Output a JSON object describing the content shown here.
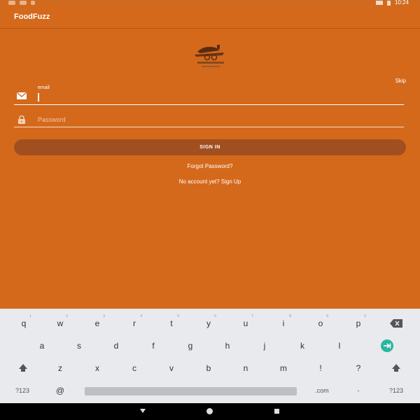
{
  "status_bar": {
    "time": "10:24"
  },
  "app_bar": {
    "title": "FoodFuzz"
  },
  "logo": {
    "icon": "restaurant-logo"
  },
  "skip_label": "Skip",
  "email_field": {
    "label": "email",
    "value": "",
    "icon": "envelope-icon"
  },
  "password_field": {
    "placeholder": "Password",
    "icon": "lock-icon"
  },
  "sign_in_label": "SIGN IN",
  "forgot_password_label": "Forgot Password?",
  "signup_prompt": "No account yet? Sign Up",
  "keyboard": {
    "row1": [
      {
        "k": "q",
        "h": "1"
      },
      {
        "k": "w",
        "h": "2"
      },
      {
        "k": "e",
        "h": "3"
      },
      {
        "k": "r",
        "h": "4"
      },
      {
        "k": "t",
        "h": "5"
      },
      {
        "k": "y",
        "h": "6"
      },
      {
        "k": "u",
        "h": "7"
      },
      {
        "k": "i",
        "h": "8"
      },
      {
        "k": "o",
        "h": "9"
      },
      {
        "k": "p",
        "h": "0"
      }
    ],
    "row2": [
      "a",
      "s",
      "d",
      "f",
      "g",
      "h",
      "j",
      "k",
      "l"
    ],
    "row3": [
      "z",
      "x",
      "c",
      "v",
      "b",
      "n",
      "m",
      "!",
      "?"
    ],
    "row4": {
      "sym_left": "?123",
      "at": "@",
      "dotcom": ".com",
      "dash": "-",
      "sym_right": "?123"
    }
  },
  "colors": {
    "primary": "#d4691c",
    "button": "#a24f20",
    "keyboard_bg": "#e8eaed",
    "accent_enter": "#2bb5a0"
  }
}
